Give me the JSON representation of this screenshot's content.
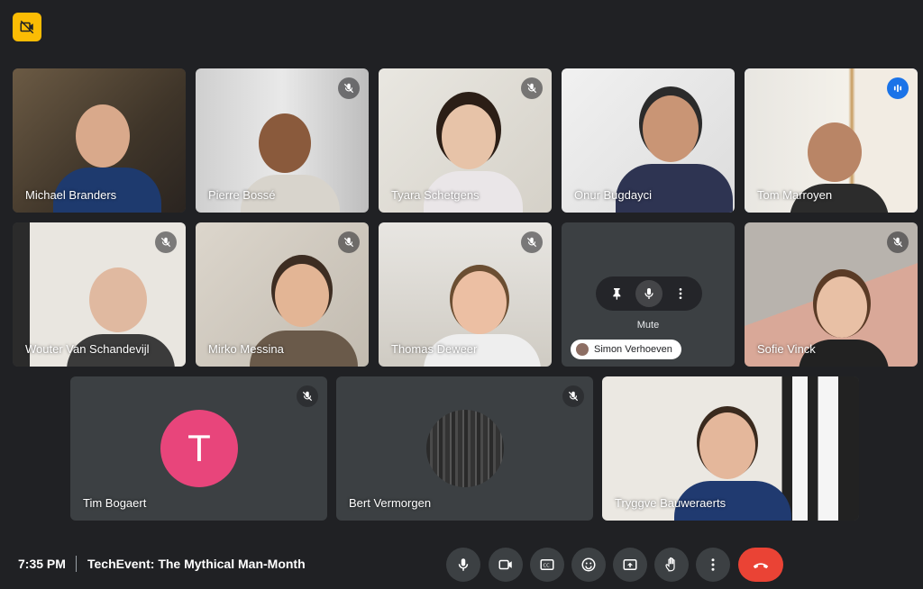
{
  "meeting": {
    "time": "7:35 PM",
    "title": "TechEvent: The Mythical Man-Month"
  },
  "participants": [
    {
      "name": "Michael Branders",
      "muted": false
    },
    {
      "name": "Pierre Bossé",
      "muted": true
    },
    {
      "name": "Tyara Schetgens",
      "muted": true
    },
    {
      "name": "Onur Bugdayci",
      "muted": false
    },
    {
      "name": "Tom Marroyen",
      "muted": false,
      "speaking": true
    },
    {
      "name": "Wouter Van Schandevijl",
      "muted": true
    },
    {
      "name": "Mirko Messina",
      "muted": true
    },
    {
      "name": "Thomas Deweer",
      "muted": true
    },
    {
      "name": "Simon Verhoeven",
      "muted": false,
      "hover_action_label": "Mute"
    },
    {
      "name": "Sofie Vinck",
      "muted": true
    },
    {
      "name": "Tim Bogaert",
      "muted": true,
      "avatar_letter": "T"
    },
    {
      "name": "Bert Vermorgen",
      "muted": true
    },
    {
      "name": "Tryggve Bauweraerts",
      "muted": false
    }
  ],
  "controls": [
    "mic-icon",
    "camera-icon",
    "captions-icon",
    "emoji-icon",
    "present-icon",
    "raise-hand-icon",
    "more-options-icon",
    "end-call-icon"
  ],
  "colors": {
    "accent": "#fbbc04",
    "end_call": "#ea4335",
    "speaking_border": "#8ab4f8",
    "avatar_T": "#e8457b"
  }
}
